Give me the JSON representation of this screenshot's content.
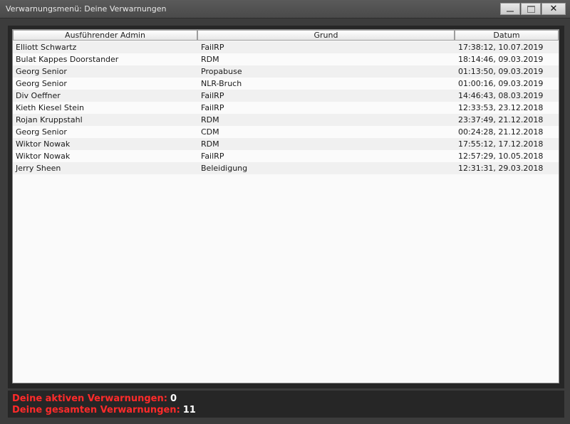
{
  "window": {
    "title": "Verwarnungsmenü: Deine Verwarnungen",
    "close_label": "✕"
  },
  "table": {
    "columns": [
      "Ausführender Admin",
      "Grund",
      "Datum"
    ],
    "rows": [
      [
        "Elliott Schwartz",
        "FailRP",
        "17:38:12, 10.07.2019"
      ],
      [
        "Bulat Kappes Doorstander",
        "RDM",
        "18:14:46, 09.03.2019"
      ],
      [
        "Georg Senior",
        "Propabuse",
        "01:13:50, 09.03.2019"
      ],
      [
        "Georg Senior",
        "NLR-Bruch",
        "01:00:16, 09.03.2019"
      ],
      [
        "Div Oeffner",
        "FailRP",
        "14:46:43, 08.03.2019"
      ],
      [
        "Kieth Kiesel Stein",
        "FailRP",
        "12:33:53, 23.12.2018"
      ],
      [
        "Rojan Kruppstahl",
        "RDM",
        "23:37:49, 21.12.2018"
      ],
      [
        "Georg Senior",
        "CDM",
        "00:24:28, 21.12.2018"
      ],
      [
        "Wiktor Nowak",
        "RDM",
        "17:55:12, 17.12.2018"
      ],
      [
        "Wiktor Nowak",
        "FailRP",
        "12:57:29, 10.05.2018"
      ],
      [
        "Jerry Sheen",
        "Beleidigung",
        "12:31:31, 29.03.2018"
      ]
    ]
  },
  "footer": {
    "active_label": "Deine aktiven Verwarnungen:",
    "active_value": "0",
    "total_label": "Deine gesamten Verwarnungen:",
    "total_value": "11"
  },
  "colors": {
    "label_red": "#ff2a2a",
    "value_white": "#ffffff",
    "panel_bg": "#262626",
    "table_bg": "#fafafa"
  }
}
